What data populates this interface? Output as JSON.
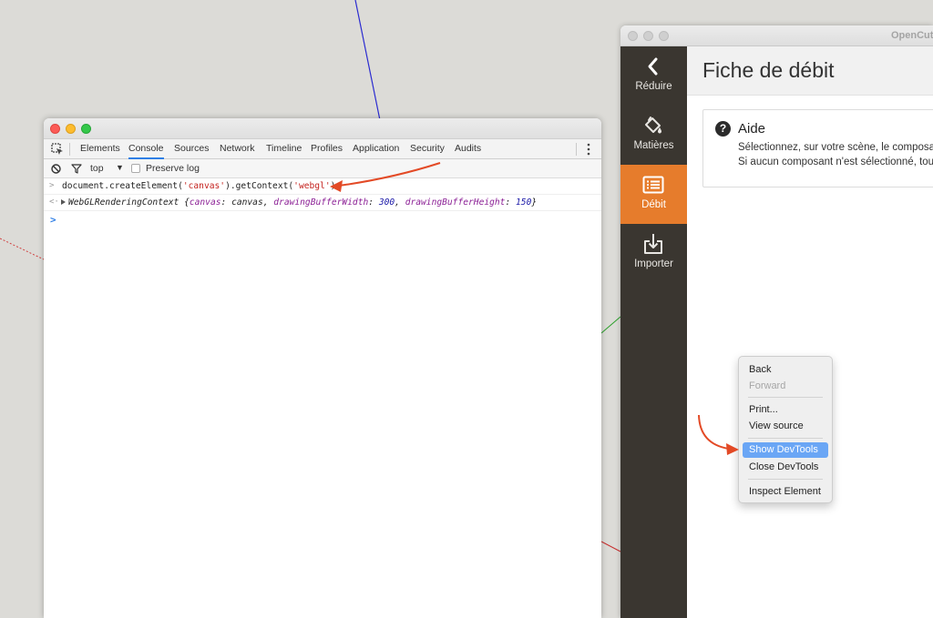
{
  "opencut": {
    "window_title": "OpenCut",
    "sidebar": [
      {
        "id": "reduire",
        "label": "Réduire",
        "icon": "chevron-left-icon",
        "active": false
      },
      {
        "id": "matieres",
        "label": "Matières",
        "icon": "paint-bucket-icon",
        "active": false
      },
      {
        "id": "debit",
        "label": "Débit",
        "icon": "list-icon",
        "active": true
      },
      {
        "id": "importer",
        "label": "Importer",
        "icon": "import-icon",
        "active": false
      }
    ],
    "page_title": "Fiche de débit",
    "help": {
      "title": "Aide",
      "line1": "Sélectionnez, sur votre scène, le composa",
      "line2": "Si aucun composant n'est sélectionné, tou"
    },
    "accent_color": "#e67c2c",
    "sidebar_color": "#3a3630"
  },
  "context_menu": {
    "items": {
      "back": "Back",
      "forward": "Forward",
      "print": "Print...",
      "view_source": "View source",
      "show_devtools": "Show DevTools",
      "close_devtools": "Close DevTools",
      "inspect_element": "Inspect Element"
    },
    "disabled": [
      "forward"
    ],
    "highlighted": "show_devtools",
    "highlight_color": "#6aa6f5"
  },
  "devtools": {
    "tabs": {
      "elements": "Elements",
      "console": "Console",
      "sources": "Sources",
      "network": "Network",
      "timeline": "Timeline",
      "profiles": "Profiles",
      "application": "Application",
      "security": "Security",
      "audits": "Audits"
    },
    "active_tab": "console",
    "toolbar": {
      "context": "top",
      "preserve_log": "Preserve log",
      "preserve_log_checked": false
    },
    "console": {
      "input": {
        "prefix": ">",
        "p1": "document.createElement(",
        "s1": "'canvas'",
        "p2": ").getContext(",
        "s2": "'webgl'",
        "p3": ");"
      },
      "output": {
        "prefix": "<·",
        "obj": "WebGLRenderingContext {",
        "k1": "canvas",
        "sep1": ": canvas, ",
        "k2": "drawingBufferWidth",
        "sep2": ": ",
        "v2": "300",
        "sep3": ", ",
        "k3": "drawingBufferHeight",
        "sep4": ": ",
        "v3": "150",
        "close": "}"
      },
      "prompt": ">"
    }
  },
  "annotation_color": "#e34a26"
}
